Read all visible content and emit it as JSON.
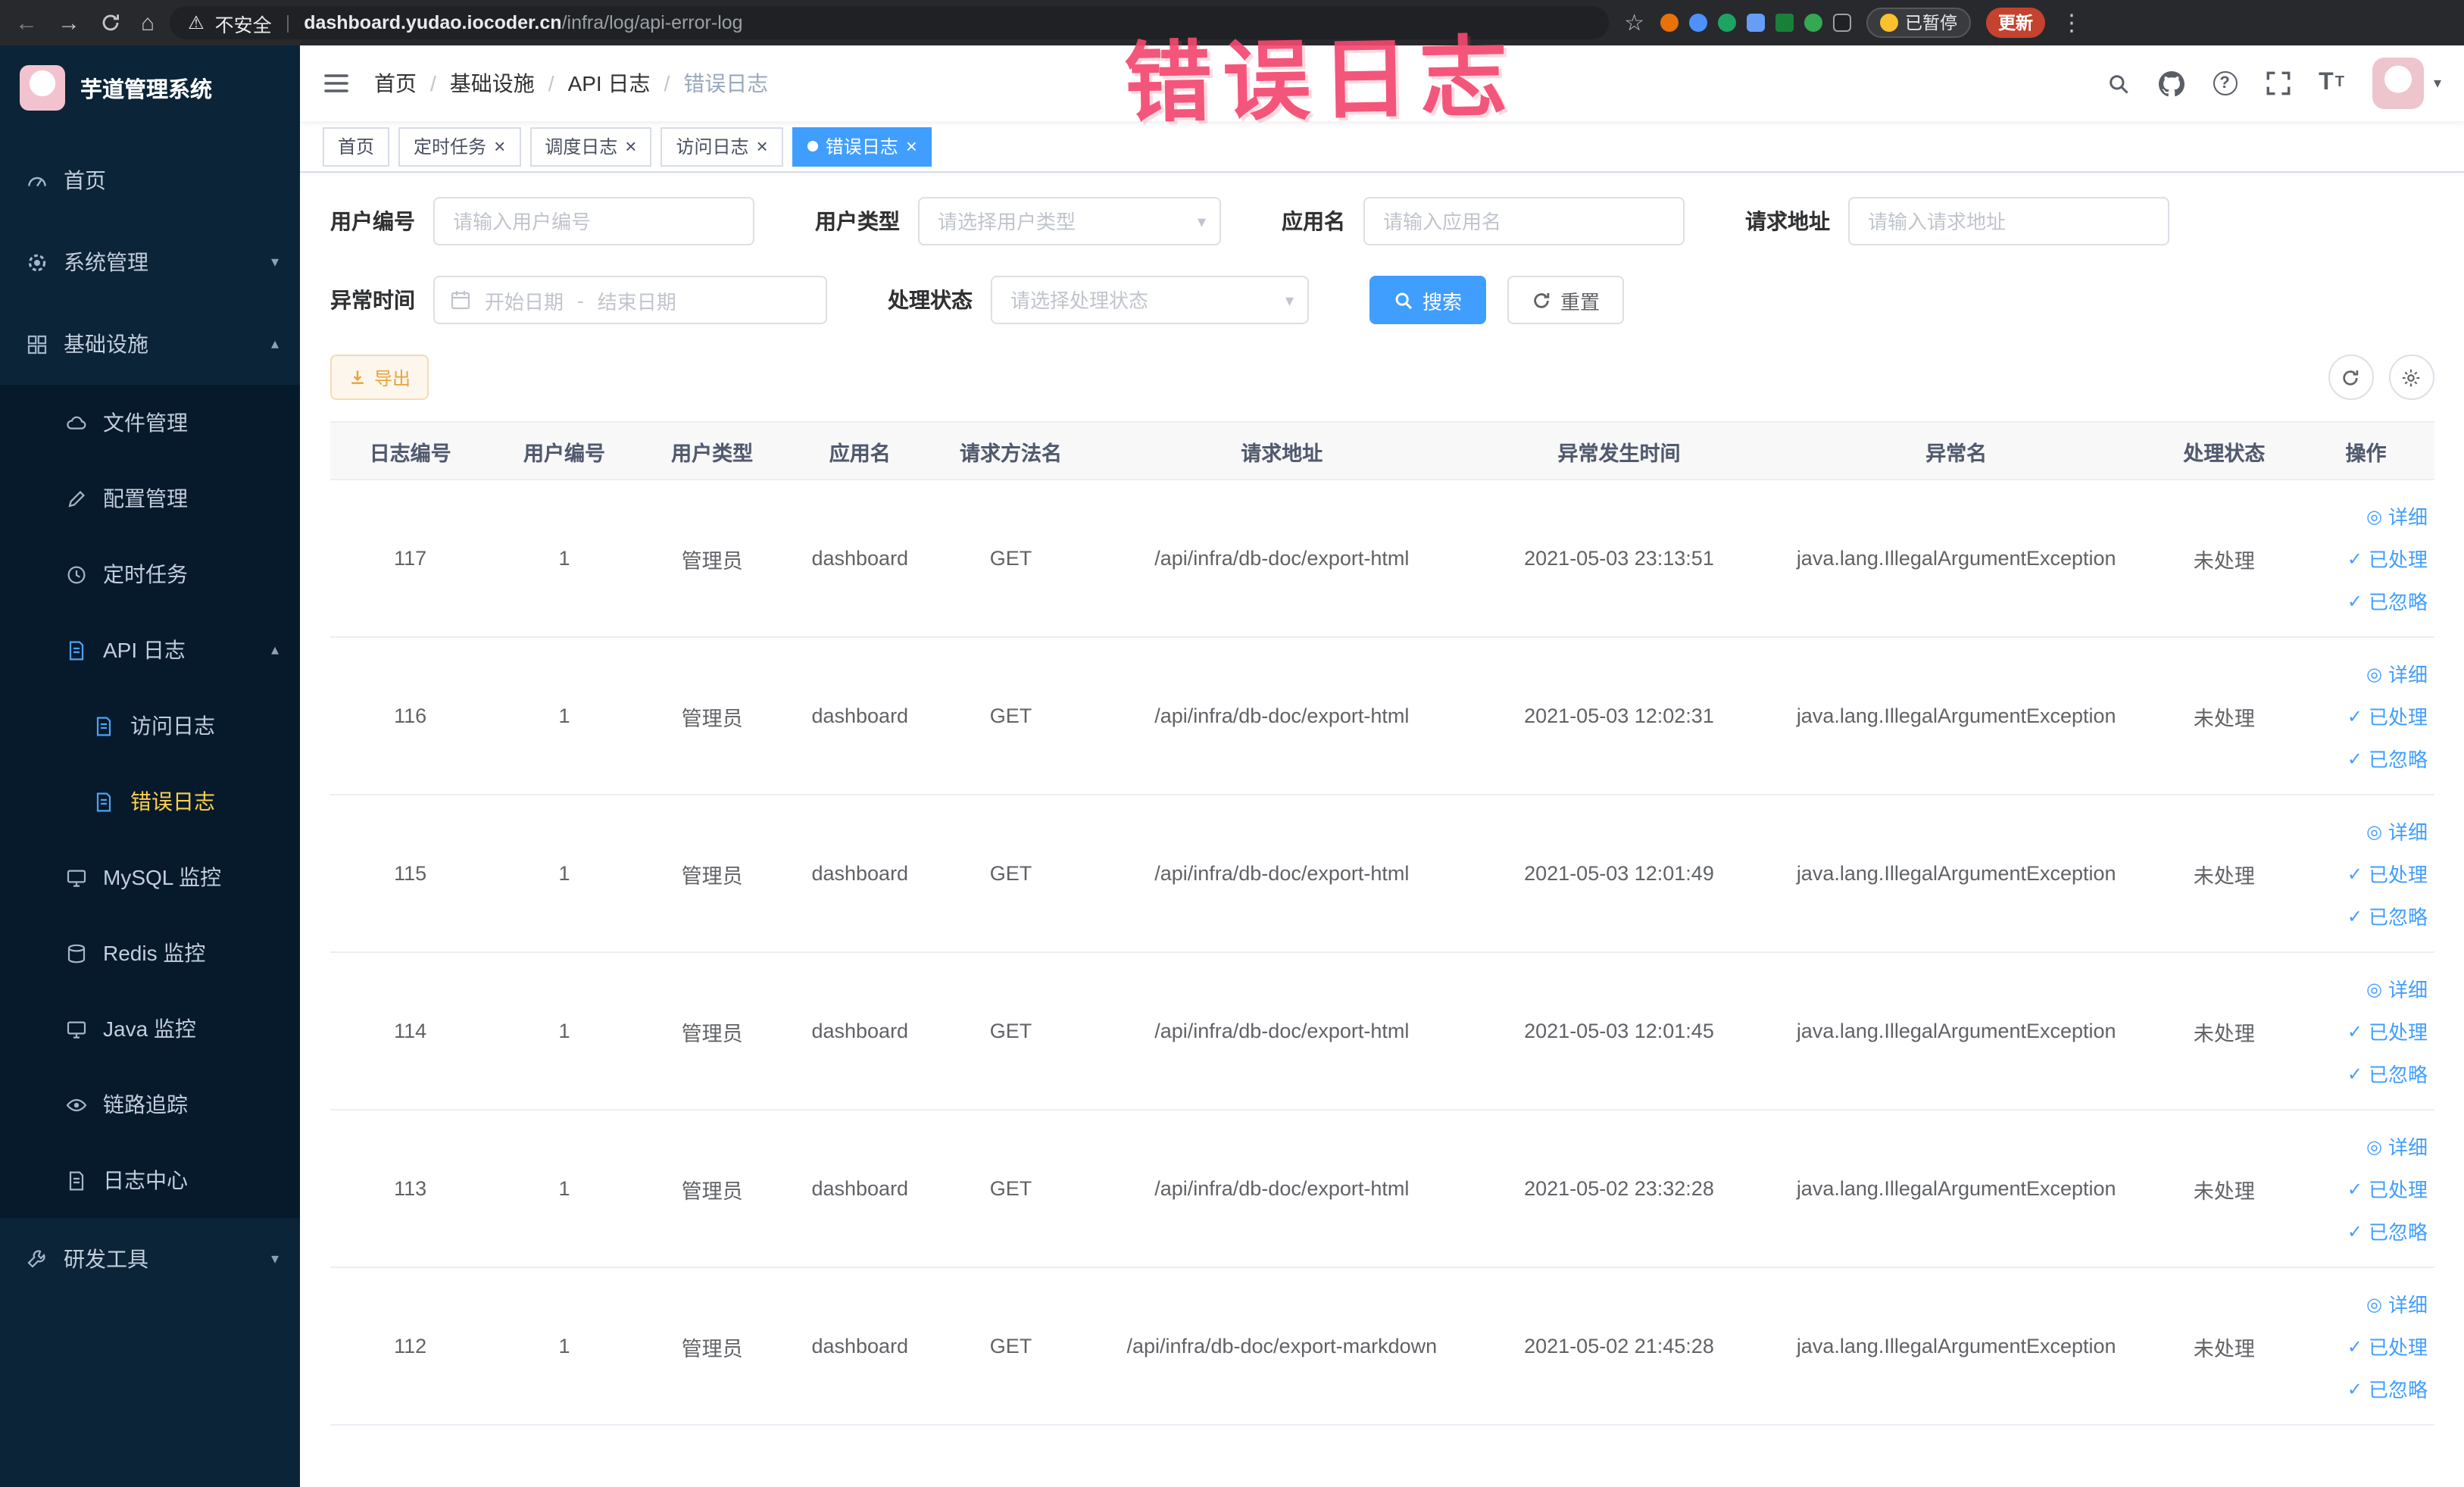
{
  "colors": {
    "primary": "#409eff",
    "warning": "#e6a23c",
    "warning-bg": "#fdf6ec",
    "warning-border": "#f5dab1",
    "sidebar-bg": "#0b2437",
    "submenu-bg": "#061a2c",
    "active-gold": "#ffd04b",
    "annotation": "#f3486f",
    "chrome-bg": "#28292c",
    "update-red": "#c5432e"
  },
  "glyphs": {
    "back": "←",
    "forward": "→",
    "home": "⌂",
    "warning": "⚠",
    "divider": "|",
    "star": "☆",
    "dots": "⋮",
    "caret_down": "▾",
    "chevron_down": "▾",
    "chevron_up": "▴",
    "question": "?",
    "t_large": "T",
    "t_small": "T",
    "close": "×",
    "select_caret": "▾",
    "range_separator": "-",
    "detail": "◎",
    "check": "✓"
  },
  "annotation": "错误日志",
  "browser": {
    "security_label": "不安全",
    "url_domain": "dashboard.yudao.iocoder.cn",
    "url_path": "/infra/log/api-error-log",
    "paused_label": "已暂停",
    "update_label": "更新"
  },
  "sidebar": {
    "logo_title": "芋道管理系统",
    "menu": {
      "home": "首页",
      "system": "系统管理",
      "infra": "基础设施",
      "file": "文件管理",
      "config": "配置管理",
      "job": "定时任务",
      "apilog": "API 日志",
      "accesslog": "访问日志",
      "errorlog": "错误日志",
      "mysql": "MySQL 监控",
      "redis": "Redis 监控",
      "java": "Java 监控",
      "trace": "链路追踪",
      "logcenter": "日志中心",
      "devtools": "研发工具"
    }
  },
  "breadcrumb": {
    "separator": "/",
    "items": [
      "首页",
      "基础设施",
      "API 日志",
      "错误日志"
    ]
  },
  "tabs": {
    "items": [
      {
        "label": "首页"
      },
      {
        "label": "定时任务"
      },
      {
        "label": "调度日志"
      },
      {
        "label": "访问日志"
      },
      {
        "label": "错误日志"
      }
    ]
  },
  "filters": {
    "user_id": {
      "label": "用户编号",
      "placeholder": "请输入用户编号"
    },
    "user_type": {
      "label": "用户类型",
      "placeholder": "请选择用户类型"
    },
    "app_name": {
      "label": "应用名",
      "placeholder": "请输入应用名"
    },
    "request_url": {
      "label": "请求地址",
      "placeholder": "请输入请求地址"
    },
    "exception_time": {
      "label": "异常时间",
      "start_placeholder": "开始日期",
      "end_placeholder": "结束日期"
    },
    "process_status": {
      "label": "处理状态",
      "placeholder": "请选择处理状态"
    },
    "search_label": "搜索",
    "reset_label": "重置"
  },
  "toolbar": {
    "export_label": "导出"
  },
  "actions": {
    "detail": "详细",
    "processed": "已处理",
    "ignored": "已忽略"
  },
  "table": {
    "columns": [
      "日志编号",
      "用户编号",
      "用户类型",
      "应用名",
      "请求方法名",
      "请求地址",
      "异常发生时间",
      "异常名",
      "处理状态",
      "操作"
    ],
    "rows": [
      {
        "id": "117",
        "user_id": "1",
        "user_type": "管理员",
        "app_name": "dashboard",
        "method": "GET",
        "url": "/api/infra/db-doc/export-html",
        "time": "2021-05-03 23:13:51",
        "exception": "java.lang.IllegalArgumentException",
        "status": "未处理"
      },
      {
        "id": "116",
        "user_id": "1",
        "user_type": "管理员",
        "app_name": "dashboard",
        "method": "GET",
        "url": "/api/infra/db-doc/export-html",
        "time": "2021-05-03 12:02:31",
        "exception": "java.lang.IllegalArgumentException",
        "status": "未处理"
      },
      {
        "id": "115",
        "user_id": "1",
        "user_type": "管理员",
        "app_name": "dashboard",
        "method": "GET",
        "url": "/api/infra/db-doc/export-html",
        "time": "2021-05-03 12:01:49",
        "exception": "java.lang.IllegalArgumentException",
        "status": "未处理"
      },
      {
        "id": "114",
        "user_id": "1",
        "user_type": "管理员",
        "app_name": "dashboard",
        "method": "GET",
        "url": "/api/infra/db-doc/export-html",
        "time": "2021-05-03 12:01:45",
        "exception": "java.lang.IllegalArgumentException",
        "status": "未处理"
      },
      {
        "id": "113",
        "user_id": "1",
        "user_type": "管理员",
        "app_name": "dashboard",
        "method": "GET",
        "url": "/api/infra/db-doc/export-html",
        "time": "2021-05-02 23:32:28",
        "exception": "java.lang.IllegalArgumentException",
        "status": "未处理"
      },
      {
        "id": "112",
        "user_id": "1",
        "user_type": "管理员",
        "app_name": "dashboard",
        "method": "GET",
        "url": "/api/infra/db-doc/export-markdown",
        "time": "2021-05-02 21:45:28",
        "exception": "java.lang.IllegalArgumentException",
        "status": "未处理"
      }
    ]
  }
}
